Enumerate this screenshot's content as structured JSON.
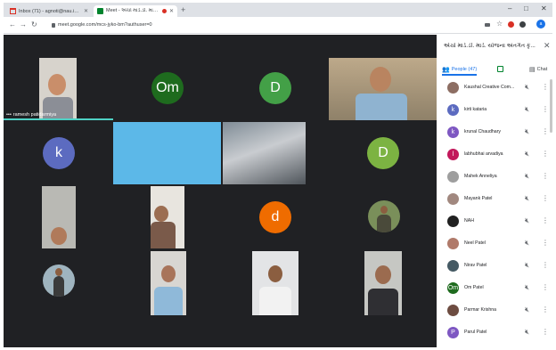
{
  "browser": {
    "tabs": [
      {
        "title": "Inbox (71) - agnoti@nau.in - Ko",
        "icon": "gmail-icon",
        "active": false
      },
      {
        "title": "Meet - એચો માર્ડ.ડી. માર્ડ. ય",
        "icon": "meet-icon",
        "active": true
      }
    ],
    "new_tab": "+",
    "url": "meet.google.com/mcs-jyko-bm?authuser=0",
    "profile_initial": "a"
  },
  "tiles": [
    {
      "kind": "video",
      "name": "ramesh patidarmiya"
    },
    {
      "kind": "avatar",
      "letter": "Om",
      "color": "#1e6b1e"
    },
    {
      "kind": "avatar",
      "letter": "D",
      "color": "#43a047"
    },
    {
      "kind": "video"
    },
    {
      "kind": "avatar",
      "letter": "k",
      "color": "#5c6bc0"
    },
    {
      "kind": "video"
    },
    {
      "kind": "video"
    },
    {
      "kind": "avatar",
      "letter": "D",
      "color": "#7cb342"
    },
    {
      "kind": "video"
    },
    {
      "kind": "video"
    },
    {
      "kind": "avatar",
      "letter": "d",
      "color": "#ef6c00"
    },
    {
      "kind": "video"
    },
    {
      "kind": "video"
    },
    {
      "kind": "video"
    },
    {
      "kind": "video"
    },
    {
      "kind": "video"
    }
  ],
  "panel": {
    "title": "એચો માર્ડ.ડી. માર્ડ. યોજના અંતર્ગત કૃ...",
    "people_label": "People (47)",
    "chat_label": "Chat",
    "people": [
      {
        "name": "Kaushal Creative Com...",
        "initial": "",
        "color": "#8d6e63"
      },
      {
        "name": "kirti kataria",
        "initial": "k",
        "color": "#5c6bc0"
      },
      {
        "name": "krunal Chaudhary",
        "initial": "k",
        "color": "#7e57c2"
      },
      {
        "name": "labhubhai arvadiya",
        "initial": "l",
        "color": "#c2185b"
      },
      {
        "name": "Mahek Anneliya",
        "initial": "",
        "color": "#9e9e9e"
      },
      {
        "name": "Mayank Patel",
        "initial": "",
        "color": "#a1887f"
      },
      {
        "name": "NAH",
        "initial": "",
        "color": "#212121"
      },
      {
        "name": "Neel Patel",
        "initial": "",
        "color": "#b07a6a"
      },
      {
        "name": "Nirav Patel",
        "initial": "",
        "color": "#455a64"
      },
      {
        "name": "Om Patel",
        "initial": "Om",
        "color": "#1e6b1e"
      },
      {
        "name": "Parmar Krishna",
        "initial": "",
        "color": "#6d4c41"
      },
      {
        "name": "Parul Patel",
        "initial": "P",
        "color": "#7e57c2"
      }
    ]
  }
}
